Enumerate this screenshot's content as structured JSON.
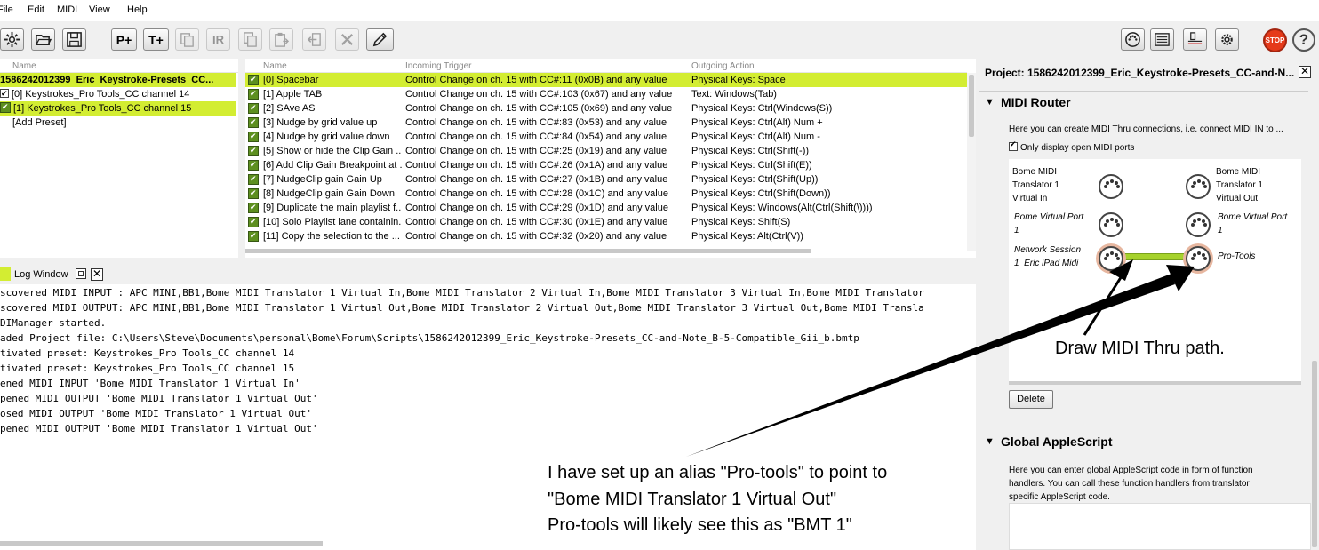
{
  "menu": [
    "File",
    "Edit",
    "MIDI",
    "View",
    "Help"
  ],
  "toolbar": {
    "left_icons": [
      "settings-icon",
      "open-folder-icon",
      "save-icon",
      "add-preset-icon",
      "add-translator-icon",
      "duplicate-icon",
      "rename-icon",
      "copy-icon",
      "paste-icon",
      "move-icon",
      "delete-icon",
      "edit-pencil-icon"
    ],
    "add_preset_label": "P+",
    "add_translator_label": "T+",
    "rename_label": "IR",
    "right_icons": [
      "midi-port-icon",
      "keyboard-icon",
      "router-icon",
      "gear-icon",
      "stop-icon",
      "help-icon"
    ],
    "stop_label": "STOP"
  },
  "presets": {
    "header": "Name",
    "project_name": "1586242012399_Eric_Keystroke-Presets_CC...",
    "items": [
      {
        "label": "[0] Keystrokes_Pro Tools_CC channel 14"
      },
      {
        "label": "[1] Keystrokes_Pro Tools_CC channel 15"
      }
    ],
    "add_label": "[Add Preset]"
  },
  "translators": {
    "headers": [
      "Name",
      "Incoming Trigger",
      "Outgoing Action"
    ],
    "rows": [
      {
        "name": "[0] Spacebar",
        "incoming": "Control Change on ch. 15 with CC#:11 (0x0B) and any value",
        "outgoing": "Physical Keys: Space"
      },
      {
        "name": "[1] Apple TAB",
        "incoming": "Control Change on ch. 15 with CC#:103 (0x67) and any value",
        "outgoing": "Text: Windows(Tab)"
      },
      {
        "name": "[2] SAve AS",
        "incoming": "Control Change on ch. 15 with CC#:105 (0x69) and any value",
        "outgoing": "Physical Keys: Ctrl(Windows(S))"
      },
      {
        "name": "[3] Nudge by grid value up",
        "incoming": "Control Change on ch. 15 with CC#:83 (0x53) and any value",
        "outgoing": "Physical Keys: Ctrl(Alt) Num +"
      },
      {
        "name": "[4] Nudge by grid value down",
        "incoming": "Control Change on ch. 15 with CC#:84 (0x54) and any value",
        "outgoing": "Physical Keys: Ctrl(Alt) Num -"
      },
      {
        "name": "[5] Show or hide the Clip Gain ...",
        "incoming": "Control Change on ch. 15 with CC#:25 (0x19) and any value",
        "outgoing": "Physical Keys: Ctrl(Shift(-))"
      },
      {
        "name": "[6] Add Clip Gain Breakpoint at ...",
        "incoming": "Control Change on ch. 15 with CC#:26 (0x1A) and any value",
        "outgoing": "Physical Keys: Ctrl(Shift(E))"
      },
      {
        "name": "[7] NudgeClip gain Gain Up",
        "incoming": "Control Change on ch. 15 with CC#:27 (0x1B) and any value",
        "outgoing": "Physical Keys: Ctrl(Shift(Up))"
      },
      {
        "name": "[8] NudgeClip gain Gain Down",
        "incoming": "Control Change on ch. 15 with CC#:28 (0x1C) and any value",
        "outgoing": "Physical Keys: Ctrl(Shift(Down))"
      },
      {
        "name": "[9] Duplicate the main playlist f...",
        "incoming": "Control Change on ch. 15 with CC#:29 (0x1D) and any value",
        "outgoing": "Physical Keys: Windows(Alt(Ctrl(Shift(\\))))"
      },
      {
        "name": "[10] Solo Playlist lane containin...",
        "incoming": "Control Change on ch. 15 with CC#:30 (0x1E) and any value",
        "outgoing": "Physical Keys: Shift(S)"
      },
      {
        "name": "[11] Copy the selection to the ...",
        "incoming": "Control Change on ch. 15 with CC#:32 (0x20) and any value",
        "outgoing": "Physical Keys: Alt(Ctrl(V))"
      }
    ]
  },
  "log": {
    "title": "Log Window",
    "lines": [
      "scovered MIDI INPUT : APC MINI,BB1,Bome MIDI Translator 1 Virtual In,Bome MIDI Translator 2 Virtual In,Bome MIDI Translator 3 Virtual In,Bome MIDI Translator",
      "scovered MIDI OUTPUT: APC MINI,BB1,Bome MIDI Translator 1 Virtual Out,Bome MIDI Translator 2 Virtual Out,Bome MIDI Translator 3 Virtual Out,Bome MIDI Transla",
      "DIManager started.",
      "aded Project file: C:\\Users\\Steve\\Documents\\personal\\Bome\\Forum\\Scripts\\1586242012399_Eric_Keystroke-Presets_CC-and-Note_B-5-Compatible_Gii_b.bmtp",
      "tivated preset: Keystrokes_Pro Tools_CC channel 14",
      "tivated preset: Keystrokes_Pro Tools_CC channel 15",
      "ened MIDI INPUT 'Bome MIDI Translator 1 Virtual In'",
      "pened MIDI OUTPUT 'Bome MIDI Translator 1 Virtual Out'",
      "osed MIDI OUTPUT 'Bome MIDI Translator 1 Virtual Out'",
      "pened MIDI OUTPUT 'Bome MIDI Translator 1 Virtual Out'"
    ]
  },
  "project_panel": {
    "title": "Project: 1586242012399_Eric_Keystroke-Presets_CC-and-N...",
    "midi_router": {
      "title": "MIDI Router",
      "description": "Here you can create MIDI Thru connections, i.e. connect MIDI IN to ...",
      "only_open_label": "Only display open MIDI ports",
      "inputs": [
        "Bome MIDI Translator 1 Virtual In",
        "Bome Virtual Port 1",
        "Network Session 1_Eric iPad Midi"
      ],
      "outputs": [
        "Bome MIDI Translator 1 Virtual Out",
        "Bome Virtual Port 1",
        "Pro-Tools"
      ],
      "delete_label": "Delete"
    },
    "global_applescript": {
      "title": "Global AppleScript",
      "description": "Here you can enter global AppleScript code in form of function handlers. You can call these function handlers from translator specific AppleScript code."
    }
  },
  "annotations": {
    "draw_path": "Draw MIDI Thru path.",
    "alias_note": [
      "I have set up an alias \"Pro-tools\" to point to",
      "\"Bome MIDI Translator 1 Virtual Out\"",
      "Pro-tools will likely see this as \"BMT 1\""
    ]
  },
  "colors": {
    "selection": "#d3ed32",
    "thru_path": "#a6d22c",
    "stop": "#e53a1a"
  }
}
